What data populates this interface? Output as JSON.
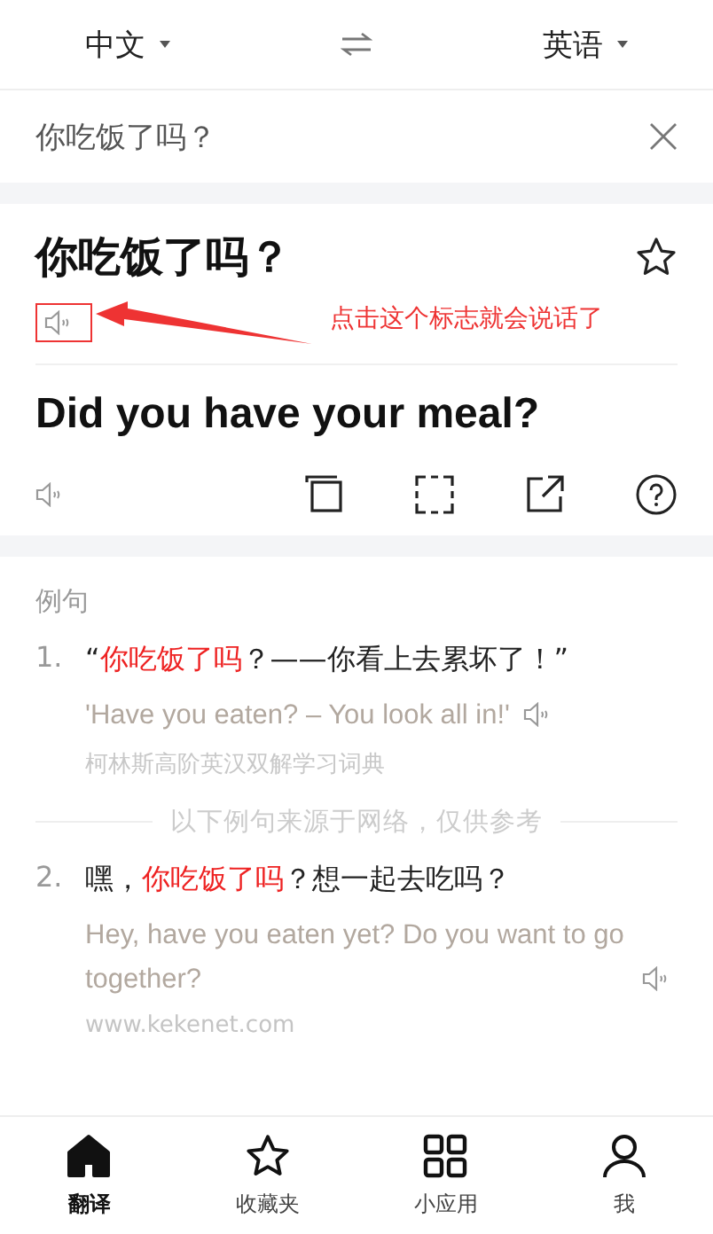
{
  "languages": {
    "source": "中文",
    "target": "英语"
  },
  "input": {
    "value": "你吃饭了吗？"
  },
  "result": {
    "source_text": "你吃饭了吗？",
    "starred": false,
    "translation": "Did you have your meal?"
  },
  "annotation": {
    "text": "点击这个标志就会说话了"
  },
  "examples": {
    "heading": "例句",
    "items": [
      {
        "number": "1.",
        "before": "“",
        "highlight": "你吃饭了吗",
        "after": "？——你看上去累坏了！”",
        "translation": "'Have you eaten? – You look all in!'",
        "source": "柯林斯高阶英汉双解学习词典"
      },
      {
        "divider_before": "以下例句来源于网络，仅供参考",
        "number": "2.",
        "before": "嘿，",
        "highlight": "你吃饭了吗",
        "after": "？想一起去吃吗？",
        "translation": "Hey, have you eaten yet? Do you want to go together?",
        "source": "www.kekenet.com"
      }
    ]
  },
  "nav": [
    {
      "label": "翻译",
      "kind": "home",
      "selected": true
    },
    {
      "label": "收藏夹",
      "kind": "star",
      "selected": false
    },
    {
      "label": "小应用",
      "kind": "grid",
      "selected": false
    },
    {
      "label": "我",
      "kind": "person",
      "selected": false
    }
  ]
}
